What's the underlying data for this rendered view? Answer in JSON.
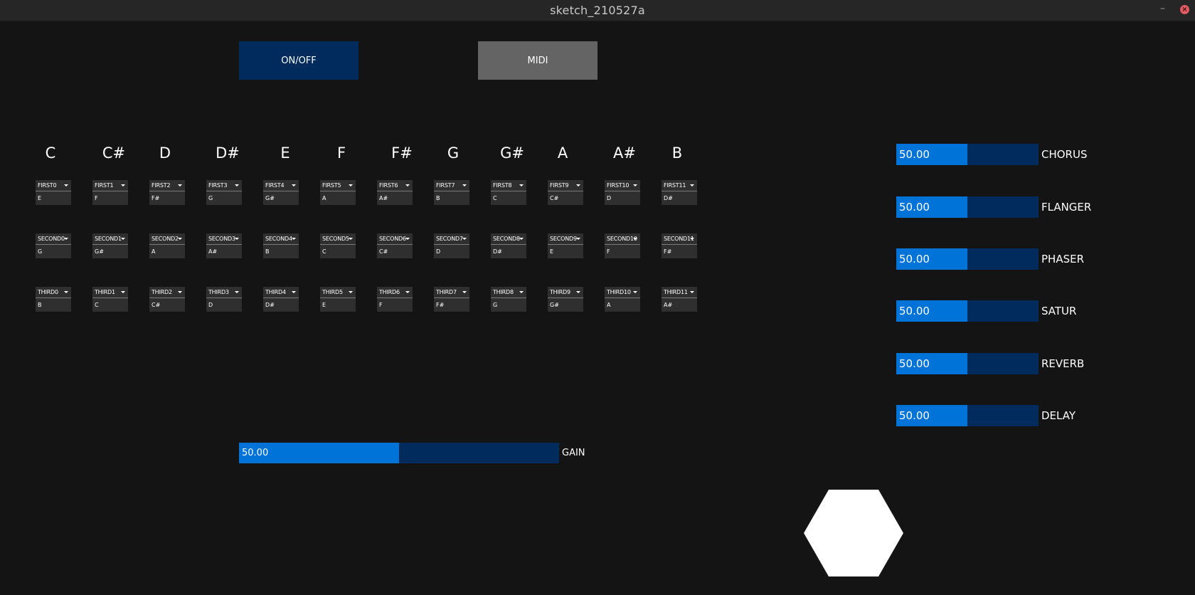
{
  "window": {
    "title": "sketch_210527a",
    "minimize_glyph": "–",
    "close_glyph": "×"
  },
  "buttons": {
    "onoff": "ON/OFF",
    "midi": "MIDI"
  },
  "colors": {
    "accent": "#0073d9",
    "track": "#002b5c",
    "button_on": "#002b5c",
    "button_off": "#646464"
  },
  "notes": [
    "C",
    "C#",
    "D",
    "D#",
    "E",
    "F",
    "F#",
    "G",
    "G#",
    "A",
    "A#",
    "B"
  ],
  "rows": [
    {
      "labels": [
        "FIRST0",
        "FIRST1",
        "FIRST2",
        "FIRST3",
        "FIRST4",
        "FIRST5",
        "FIRST6",
        "FIRST7",
        "FIRST8",
        "FIRST9",
        "FIRST10",
        "FIRST11"
      ],
      "values": [
        "E",
        "F",
        "F#",
        "G",
        "G#",
        "A",
        "A#",
        "B",
        "C",
        "C#",
        "D",
        "D#"
      ]
    },
    {
      "labels": [
        "SECOND0",
        "SECOND1",
        "SECOND2",
        "SECOND3",
        "SECOND4",
        "SECOND5",
        "SECOND6",
        "SECOND7",
        "SECOND8",
        "SECOND9",
        "SECOND10",
        "SECOND11"
      ],
      "values": [
        "G",
        "G#",
        "A",
        "A#",
        "B",
        "C",
        "C#",
        "D",
        "D#",
        "E",
        "F",
        "F#"
      ]
    },
    {
      "labels": [
        "THIRD0",
        "THIRD1",
        "THIRD2",
        "THIRD3",
        "THIRD4",
        "THIRD5",
        "THIRD6",
        "THIRD7",
        "THIRD8",
        "THIRD9",
        "THIRD10",
        "THIRD11"
      ],
      "values": [
        "B",
        "C",
        "C#",
        "D",
        "D#",
        "E",
        "F",
        "F#",
        "G",
        "G#",
        "A",
        "A#"
      ]
    }
  ],
  "effects": [
    {
      "label": "CHORUS",
      "value": "50.00",
      "fraction": 0.5
    },
    {
      "label": "FLANGER",
      "value": "50.00",
      "fraction": 0.5
    },
    {
      "label": "PHASER",
      "value": "50.00",
      "fraction": 0.5
    },
    {
      "label": "SATUR",
      "value": "50.00",
      "fraction": 0.5
    },
    {
      "label": "REVERB",
      "value": "50.00",
      "fraction": 0.5
    },
    {
      "label": "DELAY",
      "value": "50.00",
      "fraction": 0.5
    }
  ],
  "gain": {
    "label": "GAIN",
    "value": "50.00",
    "fraction": 0.5
  },
  "shape": {
    "name": "hexagon-icon",
    "color": "#ffffff"
  }
}
